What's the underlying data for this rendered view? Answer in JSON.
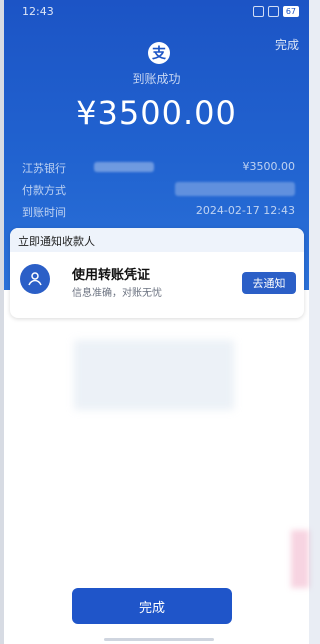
{
  "status_bar": {
    "time": "12:43",
    "battery": "67"
  },
  "header": {
    "done_label": "完成",
    "logo_glyph": "支"
  },
  "result": {
    "title": "到账成功",
    "amount": "¥3500.00"
  },
  "details": [
    {
      "label": "江苏银行",
      "value": "¥3500.00"
    },
    {
      "label": "付款方式",
      "value": ""
    },
    {
      "label": "到账时间",
      "value": "2024-02-17 12:43"
    }
  ],
  "notify_card": {
    "header": "立即通知收款人",
    "title": "使用转账凭证",
    "subtitle": "信息准确，对账无忧",
    "button_label": "去通知",
    "icon": "user-icon"
  },
  "footer": {
    "button_label": "完成"
  },
  "colors": {
    "accent": "#1F55C9",
    "header_bg": "#1C54C5"
  }
}
